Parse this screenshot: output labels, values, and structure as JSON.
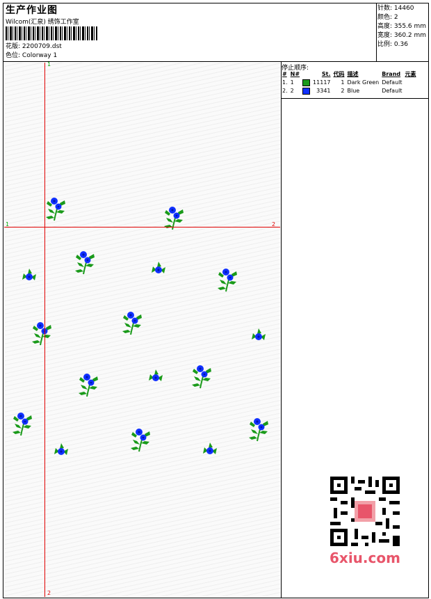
{
  "header": {
    "title": "生产作业图",
    "studio": "Wilcom(汇泉) 绣饰工作室",
    "design_file_label": "花版:",
    "design_file": "2200709.dst",
    "colorway_label": "色位:",
    "colorway": "Colorway 1"
  },
  "stats": {
    "stitches": "针数: 14460",
    "colors": "颜色: 2",
    "height": "高度: 355.6 mm",
    "width": "宽度: 360.2 mm",
    "scale": "比例: 0.36"
  },
  "legend": {
    "title": "停止顺序:",
    "headers": [
      "#",
      "N#",
      "St.",
      "代码",
      "描述",
      "Brand",
      "元素"
    ],
    "rows": [
      {
        "index": "1.",
        "needle": "1",
        "color": "#1a9a1a",
        "stitches": "11117",
        "code": "1",
        "description": "Dark Green",
        "brand": "Default"
      },
      {
        "index": "2.",
        "needle": "2",
        "color": "#1030ff",
        "stitches": "3341",
        "code": "2",
        "description": "Blue",
        "brand": "Default"
      }
    ]
  },
  "markers": {
    "top": "1",
    "left": "1",
    "right": "2",
    "bottom": "2"
  },
  "watermark": "6xiu.com",
  "colors": {
    "leaf": "#1a9a1a",
    "flower": "#1030ff",
    "guide": "#e00000"
  }
}
